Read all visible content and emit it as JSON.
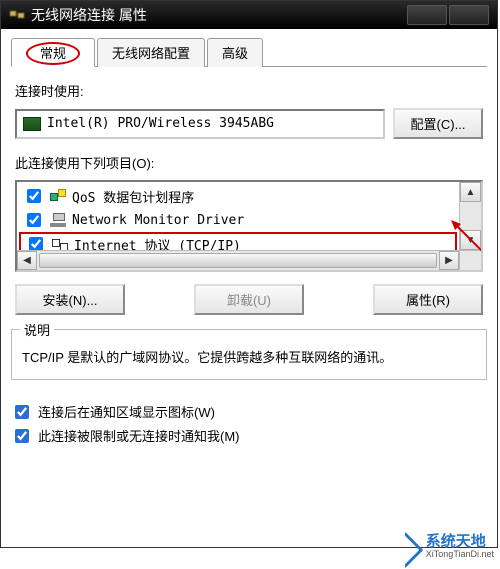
{
  "window": {
    "title": "无线网络连接 属性"
  },
  "tabs": {
    "general": "常规",
    "wireless": "无线网络配置",
    "advanced": "高级"
  },
  "adapter": {
    "label": "连接时使用:",
    "name": "Intel(R) PRO/Wireless 3945ABG",
    "configure_btn": "配置(C)..."
  },
  "items": {
    "label": "此连接使用下列项目(O):",
    "list": [
      {
        "checked": true,
        "label": "QoS 数据包计划程序"
      },
      {
        "checked": true,
        "label": "Network Monitor Driver"
      },
      {
        "checked": true,
        "label": "Internet 协议 (TCP/IP)"
      }
    ]
  },
  "buttons": {
    "install": "安装(N)...",
    "uninstall": "卸载(U)",
    "properties": "属性(R)"
  },
  "description": {
    "legend": "说明",
    "text": "TCP/IP 是默认的广域网协议。它提供跨越多种互联网络的通讯。"
  },
  "options": {
    "show_icon": "连接后在通知区域显示图标(W)",
    "notify_limited": "此连接被限制或无连接时通知我(M)"
  },
  "watermark": {
    "cn": "系统天地",
    "en": "XiTongTianDi.net"
  }
}
